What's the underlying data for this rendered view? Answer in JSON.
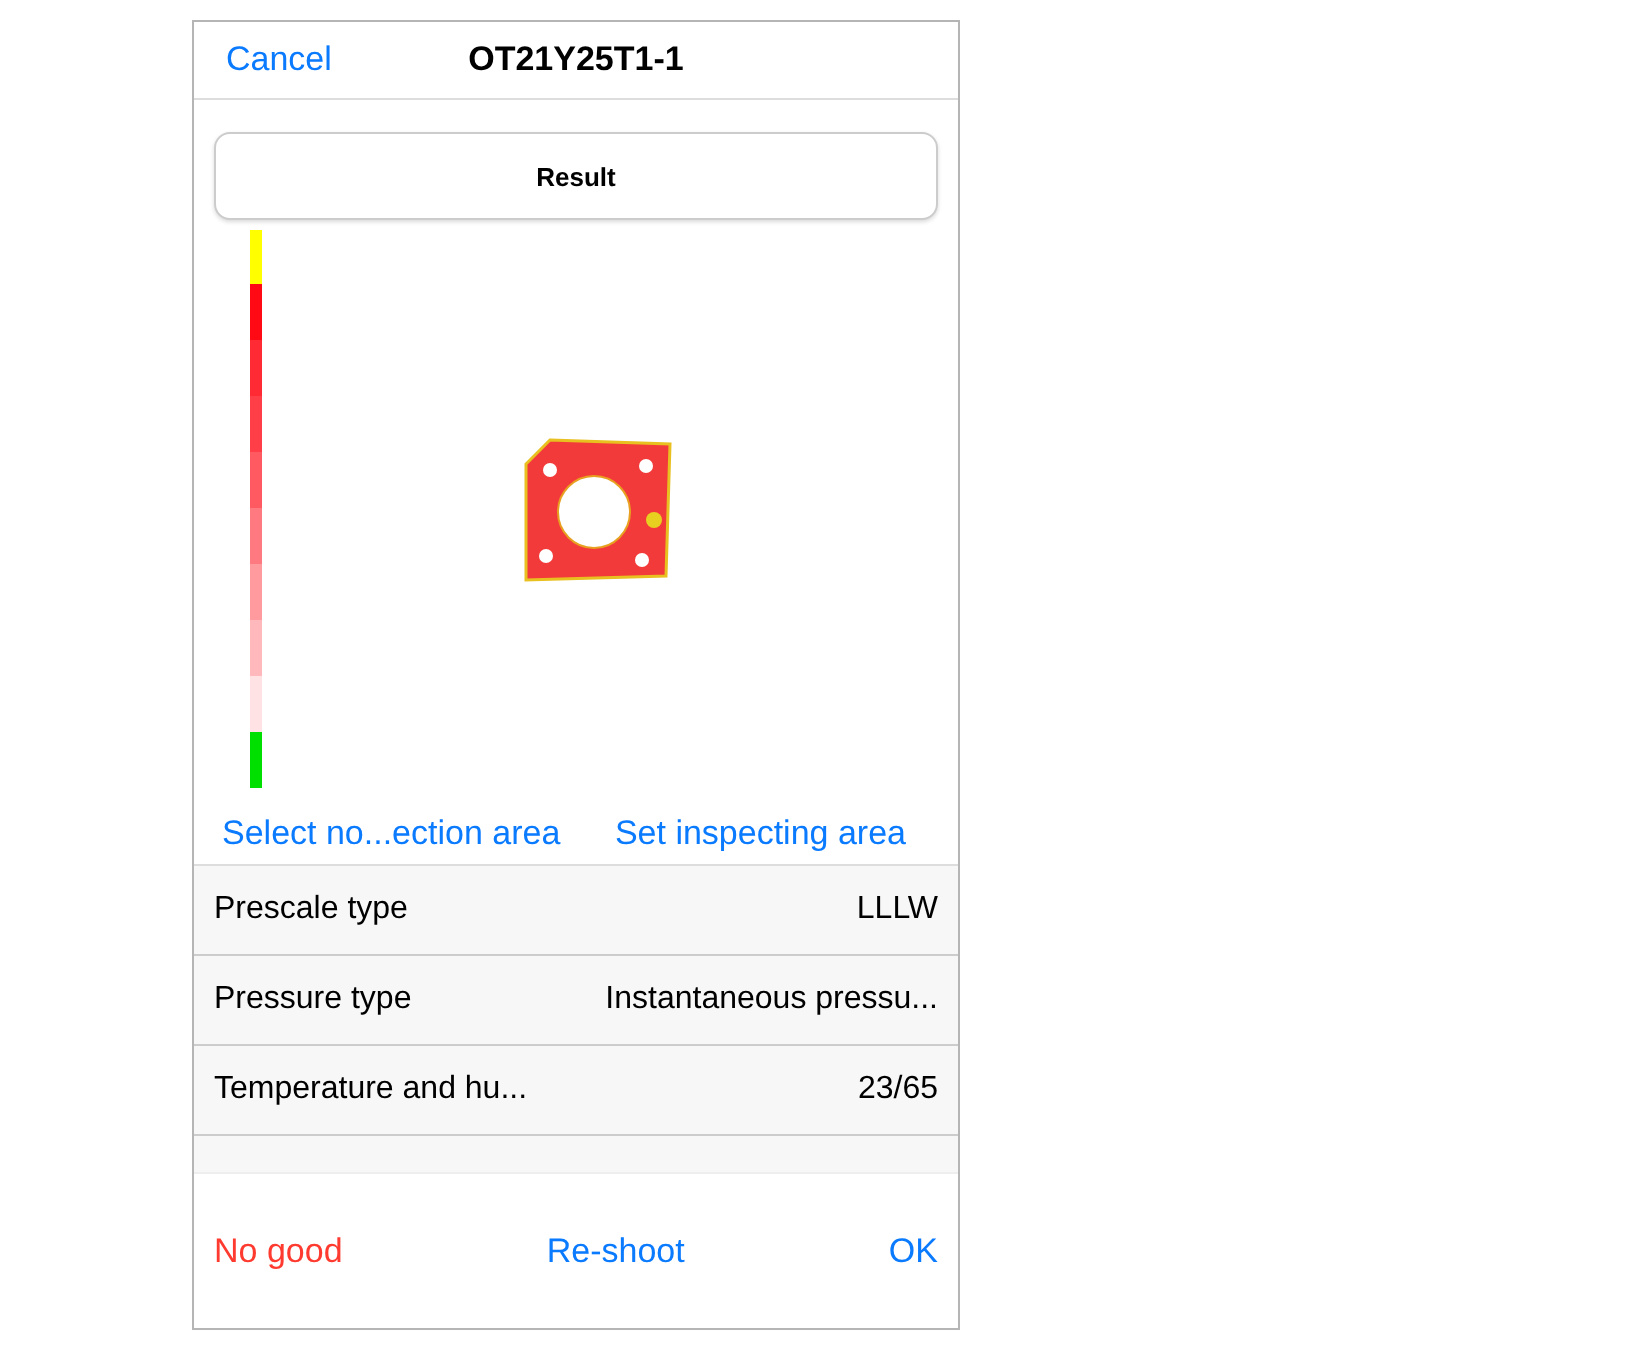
{
  "header": {
    "cancel": "Cancel",
    "title": "OT21Y25T1-1"
  },
  "result_button": "Result",
  "area_links": [
    "Select no...ection area",
    "Set inspecting area"
  ],
  "rows": [
    {
      "label": "Prescale type",
      "value": "LLLW"
    },
    {
      "label": "Pressure type",
      "value": "Instantaneous pressu..."
    },
    {
      "label": "Temperature and hu...",
      "value": "23/65"
    }
  ],
  "footer": [
    {
      "label": "No good",
      "kind": "destructive"
    },
    {
      "label": "Re-shoot",
      "kind": "normal"
    },
    {
      "label": "OK",
      "kind": "normal"
    }
  ]
}
